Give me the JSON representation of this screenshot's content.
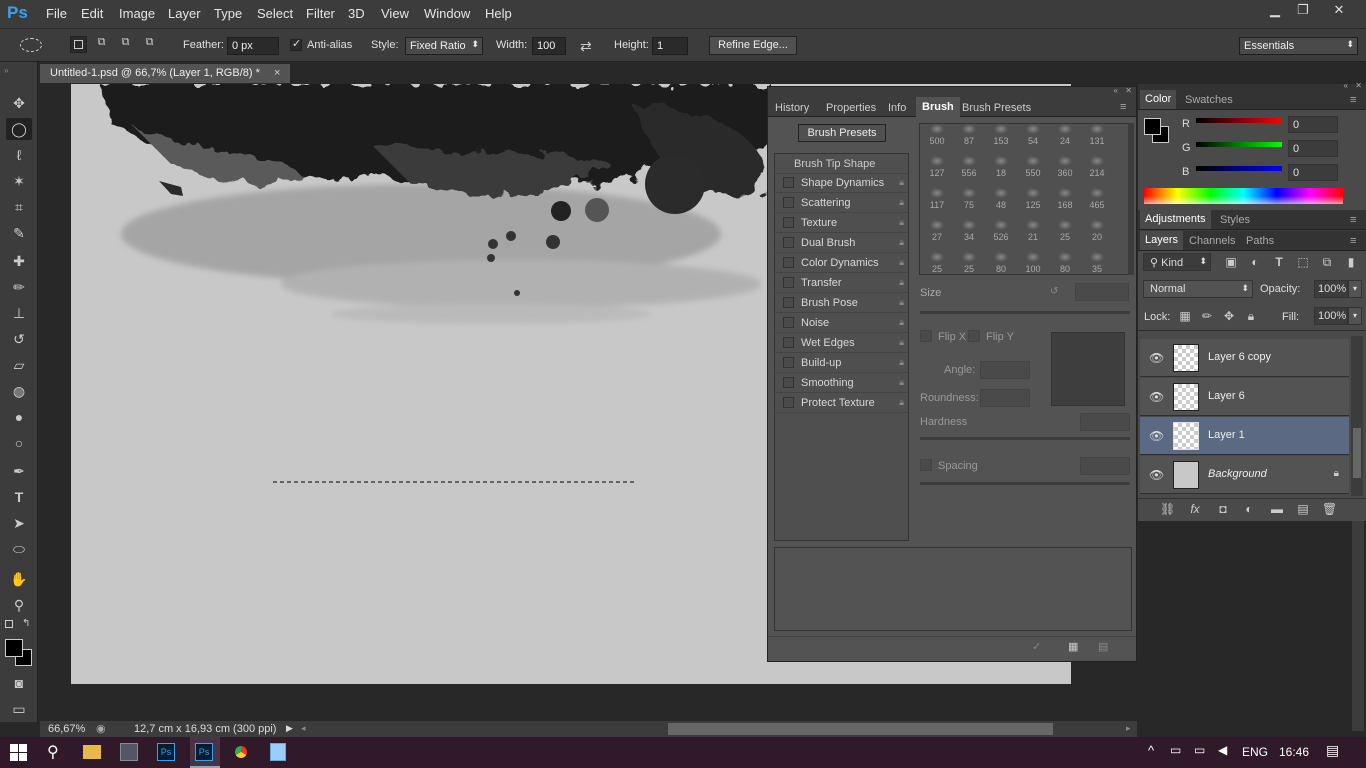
{
  "menubar": {
    "logo": "Ps",
    "items": [
      "File",
      "Edit",
      "Image",
      "Layer",
      "Type",
      "Select",
      "Filter",
      "3D",
      "View",
      "Window",
      "Help"
    ],
    "minimize": "▁",
    "restore": "❐",
    "close": "✕"
  },
  "options": {
    "feather_label": "Feather:",
    "feather_value": "0 px",
    "antialias_label": "Anti-alias",
    "style_label": "Style:",
    "style_value": "Fixed Ratio",
    "width_label": "Width:",
    "width_value": "100",
    "height_label": "Height:",
    "height_value": "1",
    "refine_edge": "Refine Edge...",
    "workspace": "Essentials"
  },
  "document": {
    "tab_title": "Untitled-1.psd @ 66,7% (Layer 1, RGB/8) *",
    "tab_close": "×"
  },
  "status": {
    "zoom": "66,67%",
    "doc_size": "12,7 cm x 16,93 cm (300 ppi)"
  },
  "brush_panel": {
    "tabs": [
      "History",
      "Properties",
      "Info",
      "Brush",
      "Brush Presets"
    ],
    "active_tab": "Brush",
    "presets_button": "Brush Presets",
    "tip_shape_header": "Brush Tip Shape",
    "options": [
      "Shape Dynamics",
      "Scattering",
      "Texture",
      "Dual Brush",
      "Color Dynamics",
      "Transfer",
      "Brush Pose",
      "Noise",
      "Wet Edges",
      "Build-up",
      "Smoothing",
      "Protect Texture"
    ],
    "tip_sizes": [
      "500",
      "87",
      "153",
      "54",
      "24",
      "131",
      "127",
      "556",
      "18",
      "550",
      "360",
      "214",
      "117",
      "75",
      "48",
      "125",
      "168",
      "465",
      "27",
      "34",
      "526",
      "21",
      "25",
      "20",
      "25",
      "25",
      "80",
      "100",
      "80",
      "35"
    ],
    "size_label": "Size",
    "flip_x": "Flip X",
    "flip_y": "Flip Y",
    "angle_label": "Angle:",
    "roundness_label": "Roundness:",
    "hardness_label": "Hardness",
    "spacing_label": "Spacing"
  },
  "color_panel": {
    "tabs": [
      "Color",
      "Swatches"
    ],
    "r_label": "R",
    "r_value": "0",
    "g_label": "G",
    "g_value": "0",
    "b_label": "B",
    "b_value": "0"
  },
  "adjust_panel": {
    "tabs": [
      "Adjustments",
      "Styles"
    ]
  },
  "layers_panel": {
    "tabs": [
      "Layers",
      "Channels",
      "Paths"
    ],
    "kind_label": "Kind",
    "blend_mode": "Normal",
    "opacity_label": "Opacity:",
    "opacity_value": "100%",
    "lock_label": "Lock:",
    "fill_label": "Fill:",
    "fill_value": "100%",
    "layers": [
      {
        "name": "Layer 6 copy"
      },
      {
        "name": "Layer 6"
      },
      {
        "name": "Layer 1"
      },
      {
        "name": "Background"
      }
    ]
  },
  "taskbar": {
    "lang": "ENG",
    "time": "16:46"
  }
}
